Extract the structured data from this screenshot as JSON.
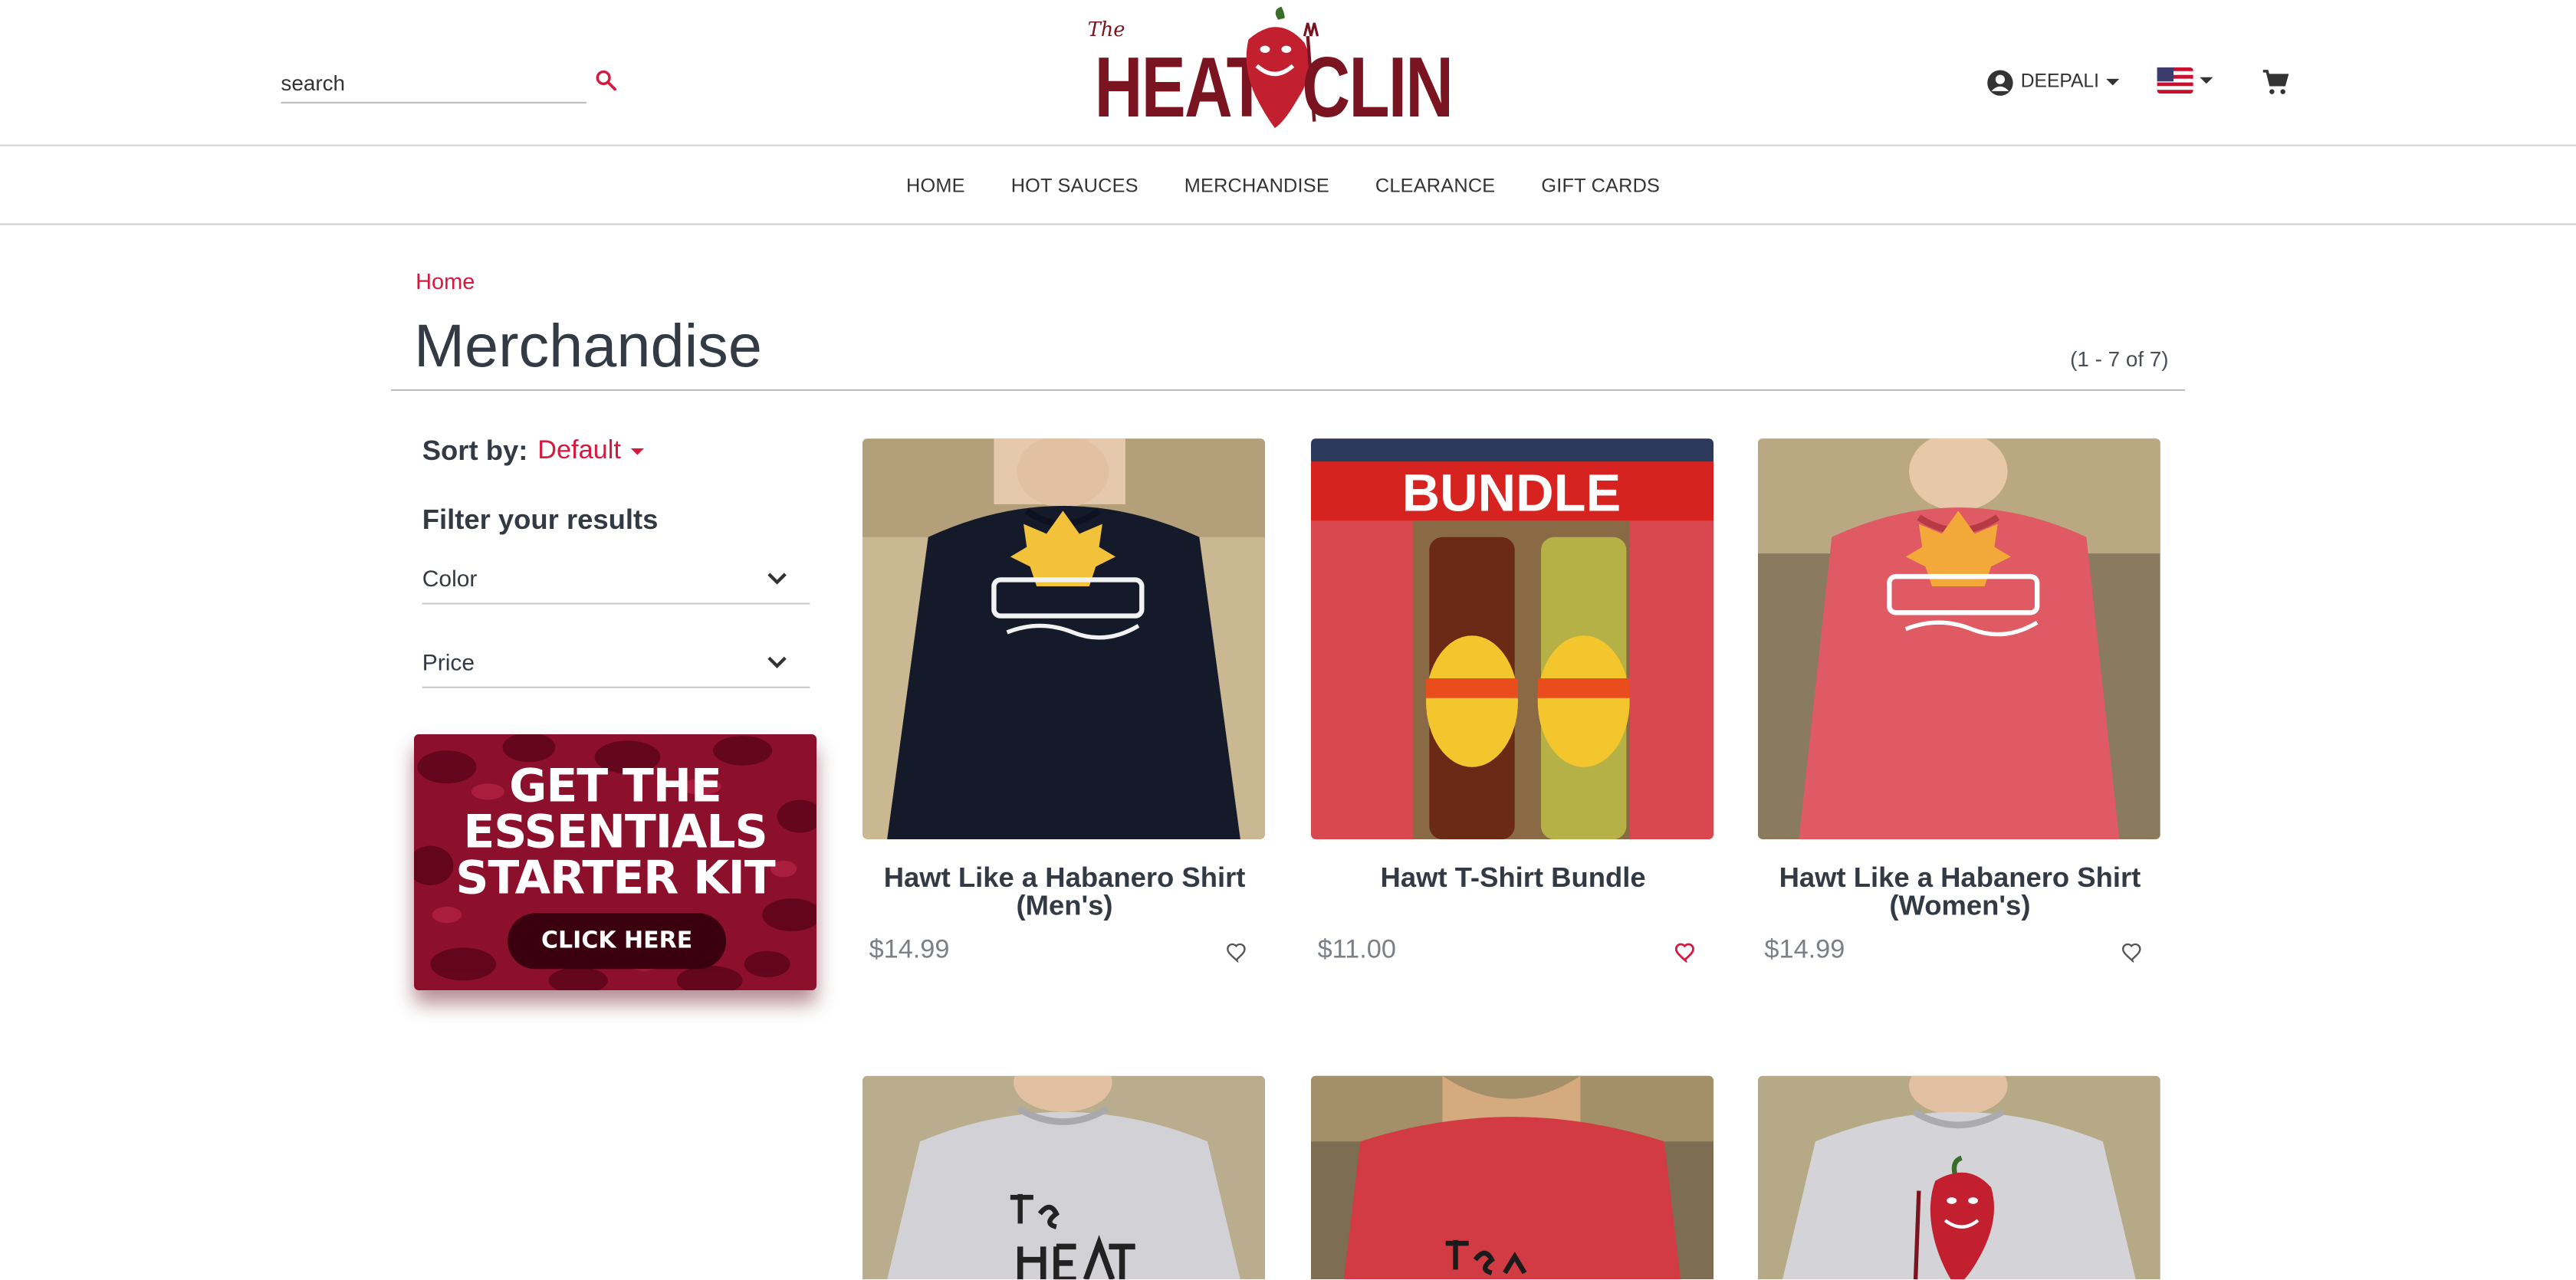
{
  "header": {
    "search_placeholder": "search",
    "user_name": "DEEPALI",
    "logo_alt": "The HEAT CLINIC",
    "logo_small": "The",
    "logo_left": "HEAT",
    "logo_right": "CLINIC"
  },
  "nav": [
    "HOME",
    "HOT SAUCES",
    "MERCHANDISE",
    "CLEARANCE",
    "GIFT CARDS"
  ],
  "breadcrumb": "Home",
  "page": {
    "title": "Merchandise",
    "count": "(1 - 7 of 7)"
  },
  "sort": {
    "label": "Sort by:",
    "value": "Default"
  },
  "filters": {
    "heading": "Filter your results",
    "facets": [
      "Color",
      "Price"
    ]
  },
  "promo": {
    "line1": "GET THE",
    "line2": "ESSENTIALS",
    "line3": "STARTER KIT",
    "button": "CLICK HERE"
  },
  "products": [
    {
      "name": "Hawt Like a Habanero Shirt (Men's)",
      "price": "$14.99",
      "favorite": false
    },
    {
      "name": "Hawt T-Shirt Bundle",
      "price": "$11.00",
      "favorite": true,
      "banner": "BUNDLE"
    },
    {
      "name": "Hawt Like a Habanero Shirt (Women's)",
      "price": "$14.99",
      "favorite": false
    }
  ],
  "colors": {
    "accent": "#d7193f",
    "text": "#333a44",
    "price": "#7b8088"
  }
}
